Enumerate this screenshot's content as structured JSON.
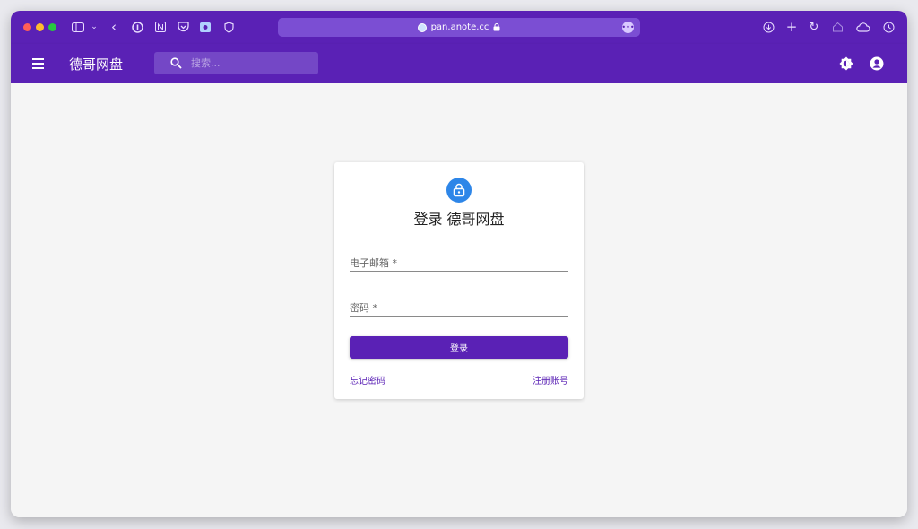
{
  "browser": {
    "url": "pan.anote.cc",
    "colors": {
      "close": "#ff5f57",
      "minimize": "#febc2e",
      "zoom": "#28c840"
    }
  },
  "app": {
    "title": "德哥网盘",
    "search_placeholder": "搜索...",
    "accent": "#5a21b5"
  },
  "login": {
    "title": "登录 德哥网盘",
    "email_label": "电子邮箱 *",
    "password_label": "密码 *",
    "submit_label": "登录",
    "forgot_label": "忘记密码",
    "register_label": "注册账号"
  }
}
